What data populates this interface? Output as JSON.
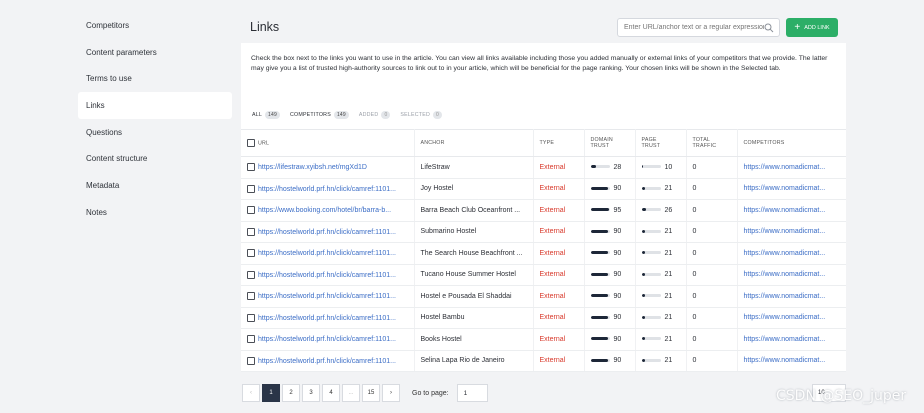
{
  "sidebar": {
    "items": [
      {
        "label": "Competitors"
      },
      {
        "label": "Content parameters"
      },
      {
        "label": "Terms to use"
      },
      {
        "label": "Links"
      },
      {
        "label": "Questions"
      },
      {
        "label": "Content structure"
      },
      {
        "label": "Metadata"
      },
      {
        "label": "Notes"
      }
    ]
  },
  "header": {
    "title": "Links",
    "search_placeholder": "Enter URL/anchor text or a regular expression",
    "add_label": "ADD LINK"
  },
  "description": "Check the box next to the links you want to use in the article. You can view all links available including those you added manually or external links of your competitors that we provide. The latter may give you a list of trusted high-authority sources to link out to in your article, which will be beneficial for the page ranking. Your chosen links will be shown in the Selected tab.",
  "tabs": [
    {
      "label": "ALL",
      "count": "149"
    },
    {
      "label": "COMPETITORS",
      "count": "149"
    },
    {
      "label": "ADDED",
      "count": "0"
    },
    {
      "label": "SELECTED",
      "count": "0"
    }
  ],
  "table": {
    "columns": {
      "url": "URL",
      "anchor": "ANCHOR",
      "type": "TYPE",
      "domain_trust_1": "DOMAIN",
      "domain_trust_2": "TRUST",
      "page_trust_1": "PAGE",
      "page_trust_2": "TRUST",
      "traffic_1": "TOTAL",
      "traffic_2": "TRAFFIC",
      "competitors": "COMPETITORS"
    },
    "rows": [
      {
        "url": "https://lifestraw.xyibsh.net/mgXd1D",
        "anchor": "LifeStraw",
        "type": "External",
        "dt": "28",
        "pt": "10",
        "traffic": "0",
        "comp": "https://www.nomadicmat..."
      },
      {
        "url": "https://hostelworld.prf.hn/click/camref:1101...",
        "anchor": "Joy Hostel",
        "type": "External",
        "dt": "90",
        "pt": "21",
        "traffic": "0",
        "comp": "https://www.nomadicmat..."
      },
      {
        "url": "https://www.booking.com/hotel/br/barra-b...",
        "anchor": "Barra Beach Club Oceanfront ...",
        "type": "External",
        "dt": "95",
        "pt": "26",
        "traffic": "0",
        "comp": "https://www.nomadicmat..."
      },
      {
        "url": "https://hostelworld.prf.hn/click/camref:1101...",
        "anchor": "Submarino Hostel",
        "type": "External",
        "dt": "90",
        "pt": "21",
        "traffic": "0",
        "comp": "https://www.nomadicmat..."
      },
      {
        "url": "https://hostelworld.prf.hn/click/camref:1101...",
        "anchor": "The Search House Beachfront ...",
        "type": "External",
        "dt": "90",
        "pt": "21",
        "traffic": "0",
        "comp": "https://www.nomadicmat..."
      },
      {
        "url": "https://hostelworld.prf.hn/click/camref:1101...",
        "anchor": "Tucano House Summer Hostel",
        "type": "External",
        "dt": "90",
        "pt": "21",
        "traffic": "0",
        "comp": "https://www.nomadicmat..."
      },
      {
        "url": "https://hostelworld.prf.hn/click/camref:1101...",
        "anchor": "Hostel e Pousada El Shaddai",
        "type": "External",
        "dt": "90",
        "pt": "21",
        "traffic": "0",
        "comp": "https://www.nomadicmat..."
      },
      {
        "url": "https://hostelworld.prf.hn/click/camref:1101...",
        "anchor": "Hostel Bambu",
        "type": "External",
        "dt": "90",
        "pt": "21",
        "traffic": "0",
        "comp": "https://www.nomadicmat..."
      },
      {
        "url": "https://hostelworld.prf.hn/click/camref:1101...",
        "anchor": "Books Hostel",
        "type": "External",
        "dt": "90",
        "pt": "21",
        "traffic": "0",
        "comp": "https://www.nomadicmat..."
      },
      {
        "url": "https://hostelworld.prf.hn/click/camref:1101...",
        "anchor": "Selina Lapa Rio de Janeiro",
        "type": "External",
        "dt": "90",
        "pt": "21",
        "traffic": "0",
        "comp": "https://www.nomadicmat..."
      }
    ]
  },
  "pagination": {
    "prev": "‹",
    "pages": [
      "1",
      "2",
      "3",
      "4",
      "...",
      "15"
    ],
    "next": "›",
    "goto_label": "Go to page:",
    "goto_value": "1",
    "per_page": "10"
  },
  "watermark": "CSDN @SEO_juper",
  "colors": {
    "accent": "#2cae67",
    "link": "#3b6dc6",
    "external": "#d8392b",
    "active_page": "#2a3548"
  }
}
